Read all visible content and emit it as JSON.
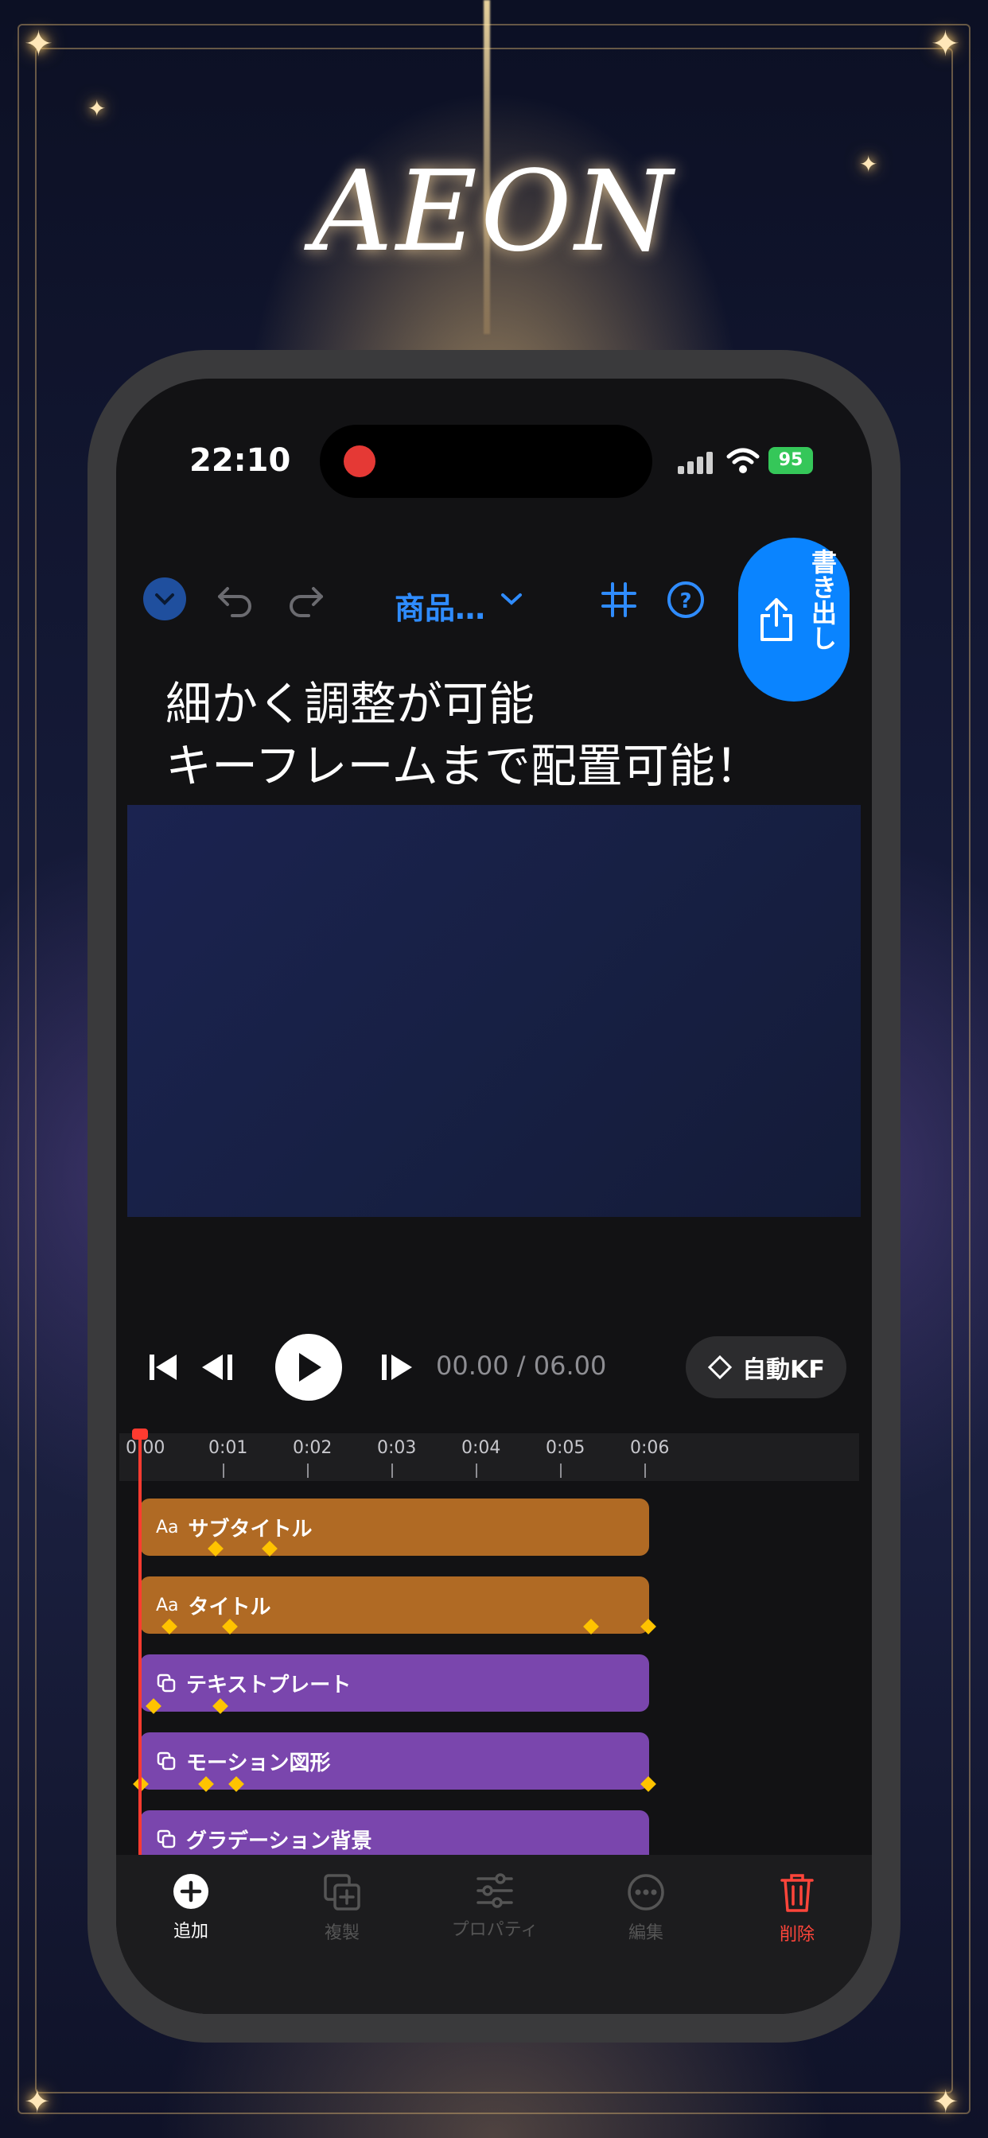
{
  "brand": {
    "logo": "AEON"
  },
  "status_bar": {
    "time": "22:10",
    "battery": "95"
  },
  "toolbar": {
    "project_title": "商品…",
    "export_label": "書き出し"
  },
  "headline": {
    "line1": "細かく調整が可能",
    "line2": "キーフレームまで配置可能！"
  },
  "playback": {
    "timecode": "00.00 / 06.00",
    "auto_kf_label": "自動KF"
  },
  "timeline": {
    "ticks": [
      "0:00",
      "0:01",
      "0:02",
      "0:03",
      "0:04",
      "0:05",
      "0:06"
    ],
    "tracks": [
      {
        "type_icon": "Aa",
        "label": "サブタイトル",
        "color": "#b06a24"
      },
      {
        "type_icon": "Aa",
        "label": "タイトル",
        "color": "#b06a24"
      },
      {
        "type_icon": "layers-icon",
        "label": "テキストプレート",
        "color": "#7a46ad"
      },
      {
        "type_icon": "layers-icon",
        "label": "モーション図形",
        "color": "#7a46ad"
      },
      {
        "type_icon": "layers-icon",
        "label": "グラデーション背景",
        "color": "#7a46ad"
      }
    ]
  },
  "bottom_bar": {
    "add": "追加",
    "duplicate": "複製",
    "properties": "プロパティ",
    "edit": "編集",
    "delete": "削除"
  },
  "colors": {
    "accent": "#0a84ff",
    "keyframe": "#ffc300",
    "playhead": "#ff3b30",
    "delete": "#ff453a"
  }
}
